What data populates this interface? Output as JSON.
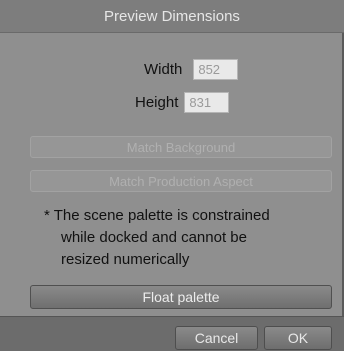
{
  "dialog": {
    "title": "Preview Dimensions",
    "width_label": "Width",
    "width_value": "852",
    "height_label": "Height",
    "height_value": "831",
    "match_background_label": "Match Background",
    "match_production_aspect_label": "Match Production Aspect",
    "note_lines": [
      "* The scene palette is constrained",
      "while docked and cannot be",
      "resized numerically"
    ],
    "float_palette_label": "Float palette",
    "cancel_label": "Cancel",
    "ok_label": "OK"
  }
}
